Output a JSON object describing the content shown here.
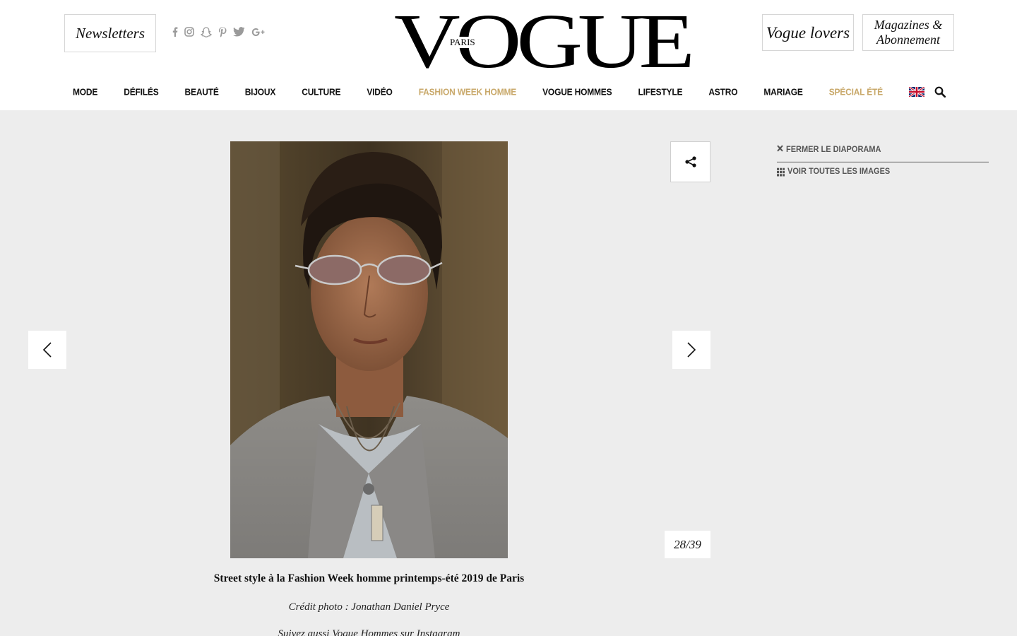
{
  "header": {
    "newsletters_label": "Newsletters",
    "vogue_lovers_label": "Vogue lovers",
    "magazines_label": "Magazines & Abonnement",
    "logo": {
      "text": "VOGUE",
      "subtext": "PARIS"
    },
    "social_icons": [
      "facebook-icon",
      "instagram-icon",
      "snapchat-icon",
      "pinterest-icon",
      "twitter-icon",
      "google-plus-icon"
    ]
  },
  "nav": {
    "items": [
      {
        "label": "Mode",
        "highlight": false
      },
      {
        "label": "Défilés",
        "highlight": false
      },
      {
        "label": "Beauté",
        "highlight": false
      },
      {
        "label": "Bijoux",
        "highlight": false
      },
      {
        "label": "Culture",
        "highlight": false
      },
      {
        "label": "Vidéo",
        "highlight": false
      },
      {
        "label": "Fashion Week Homme",
        "highlight": true
      },
      {
        "label": "Vogue Hommes",
        "highlight": false
      },
      {
        "label": "Lifestyle",
        "highlight": false
      },
      {
        "label": "Astro",
        "highlight": false
      },
      {
        "label": "Mariage",
        "highlight": false
      },
      {
        "label": "Spécial été",
        "highlight": true
      }
    ],
    "highlight_color": "#c9a96b"
  },
  "slideshow": {
    "counter": "28/39",
    "close_label": "Fermer le diaporama",
    "all_images_label": "Voir toutes les images",
    "caption_title": "Street style à la Fashion Week homme printemps-été 2019 de Paris",
    "caption_credit": "Crédit photo : Jonathan Daniel Pryce",
    "caption_follow": "Suivez aussi Vogue Hommes sur Instagram"
  },
  "colors": {
    "page_background": "#ededed",
    "header_background": "#ffffff",
    "accent_gold": "#c9a96b"
  }
}
